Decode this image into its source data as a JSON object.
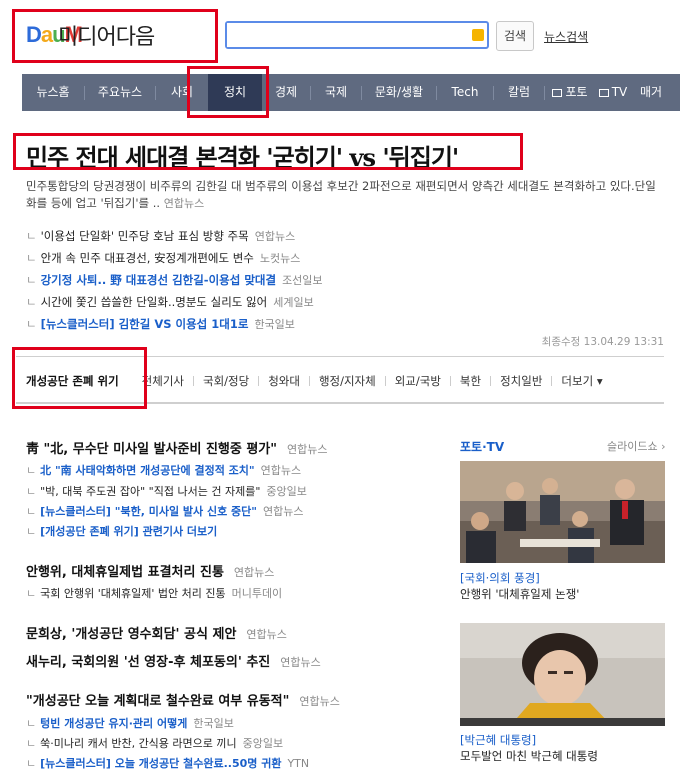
{
  "header": {
    "logo_text": "Daum",
    "logo_sub": "미디어다음",
    "search_placeholder": "",
    "search_button": "검색",
    "news_search_link": "뉴스검색"
  },
  "nav": {
    "items": [
      {
        "label": "뉴스홈"
      },
      {
        "label": "주요뉴스"
      },
      {
        "label": "사회"
      },
      {
        "label": "정치",
        "active": true
      },
      {
        "label": "경제"
      },
      {
        "label": "국제"
      },
      {
        "label": "문화/생활"
      },
      {
        "label": "Tech"
      },
      {
        "label": "칼럼"
      },
      {
        "label": "포토"
      },
      {
        "label": "TV"
      },
      {
        "label": "매거"
      }
    ]
  },
  "headline": {
    "title": "민주 전대 세대결 본격화 '굳히기' vs '뒤집기'",
    "summary": "민주통합당의 당권경쟁이 비주류의 김한길 대 범주류의 이용섭 후보간 2파전으로 재편되면서 양측간 세대결도 본격화하고 있다.단일화를 등에 업고 '뒤집기'를 ..",
    "summary_source": "연합뉴스",
    "related": [
      {
        "text": "'이용섭 단일화' 민주당 호남 표심 방향 주목",
        "source": "연합뉴스",
        "blue": false
      },
      {
        "text": "안개 속 민주 대표경선, 安정계개편에도 변수",
        "source": "노컷뉴스",
        "blue": false
      },
      {
        "text": "강기정 사퇴.. 野 대표경선 김한길-이용섭 맞대결",
        "source": "조선일보",
        "blue": true
      },
      {
        "text": "시간에 쫓긴 씁쓸한 단일화..명분도 실리도 잃어",
        "source": "세계일보",
        "blue": false
      },
      {
        "text": "[뉴스클러스터] 김한길 VS 이용섭 1대1로",
        "source": "한국일보",
        "blue": true
      }
    ],
    "updated": "최종수정 13.04.29 13:31"
  },
  "tabs": [
    {
      "label": "개성공단 존폐 위기",
      "active": true
    },
    {
      "label": "전체기사"
    },
    {
      "label": "국회/정당"
    },
    {
      "label": "청와대"
    },
    {
      "label": "행정/지자체"
    },
    {
      "label": "외교/국방"
    },
    {
      "label": "북한"
    },
    {
      "label": "정치일반"
    },
    {
      "label": "더보기 ▾"
    }
  ],
  "news": {
    "groups": [
      {
        "title": "靑 \"北, 무수단 미사일 발사준비 진행중 평가\"",
        "source": "연합뉴스",
        "subs": [
          {
            "text": "北 \"南 사태악화하면 개성공단에 결정적 조치\"",
            "source": "연합뉴스",
            "blue": true
          },
          {
            "text": "\"박, 대북 주도권 잡아\" \"직접 나서는 건 자제를\"",
            "source": "중앙일보",
            "blue": false
          },
          {
            "text": "[뉴스클러스터] \"북한, 미사일 발사 신호 중단\"",
            "source": "연합뉴스",
            "blue": true
          },
          {
            "text": "[개성공단 존폐 위기] 관련기사 더보기",
            "source": "",
            "blue": true
          }
        ]
      },
      {
        "title": "안행위, 대체휴일제법 표결처리 진통",
        "source": "연합뉴스",
        "subs": [
          {
            "text": "국회 안행위 '대체휴일제' 법안 처리 진통",
            "source": "머니투데이",
            "blue": false
          }
        ]
      },
      {
        "title": "문희상, '개성공단 영수회담' 공식 제안",
        "source": "연합뉴스",
        "subs": []
      },
      {
        "title": "새누리, 국회의원 '선 영장-후 체포동의' 추진",
        "source": "연합뉴스",
        "subs": []
      },
      {
        "title": "\"개성공단 오늘 계획대로 철수완료 여부 유동적\"",
        "source": "연합뉴스",
        "subs": [
          {
            "text": "텅빈 개성공단 유지·관리 어떻게",
            "source": "한국일보",
            "blue": true
          },
          {
            "text": "쑥·미나리 캐서 반찬, 간식용 라면으로 끼니",
            "source": "중앙일보",
            "blue": false
          },
          {
            "text": "[뉴스클러스터] 오늘 개성공단 철수완료..50명 귀환",
            "source": "YTN",
            "blue": true
          }
        ]
      }
    ]
  },
  "photo_tv": {
    "title": "포토·TV",
    "slide_link": "슬라이드쇼 ›",
    "items": [
      {
        "category": "[국회·의회 풍경]",
        "caption": "안행위 '대체휴일제 논쟁'"
      },
      {
        "category": "[박근혜 대통령]",
        "caption": "모두발언 마친 박근혜 대통령"
      }
    ]
  },
  "colors": {
    "accent_red": "#e0001b",
    "link_blue": "#1a5fc9",
    "nav_bg": "#5f6a80",
    "nav_active": "#2f3a56"
  }
}
